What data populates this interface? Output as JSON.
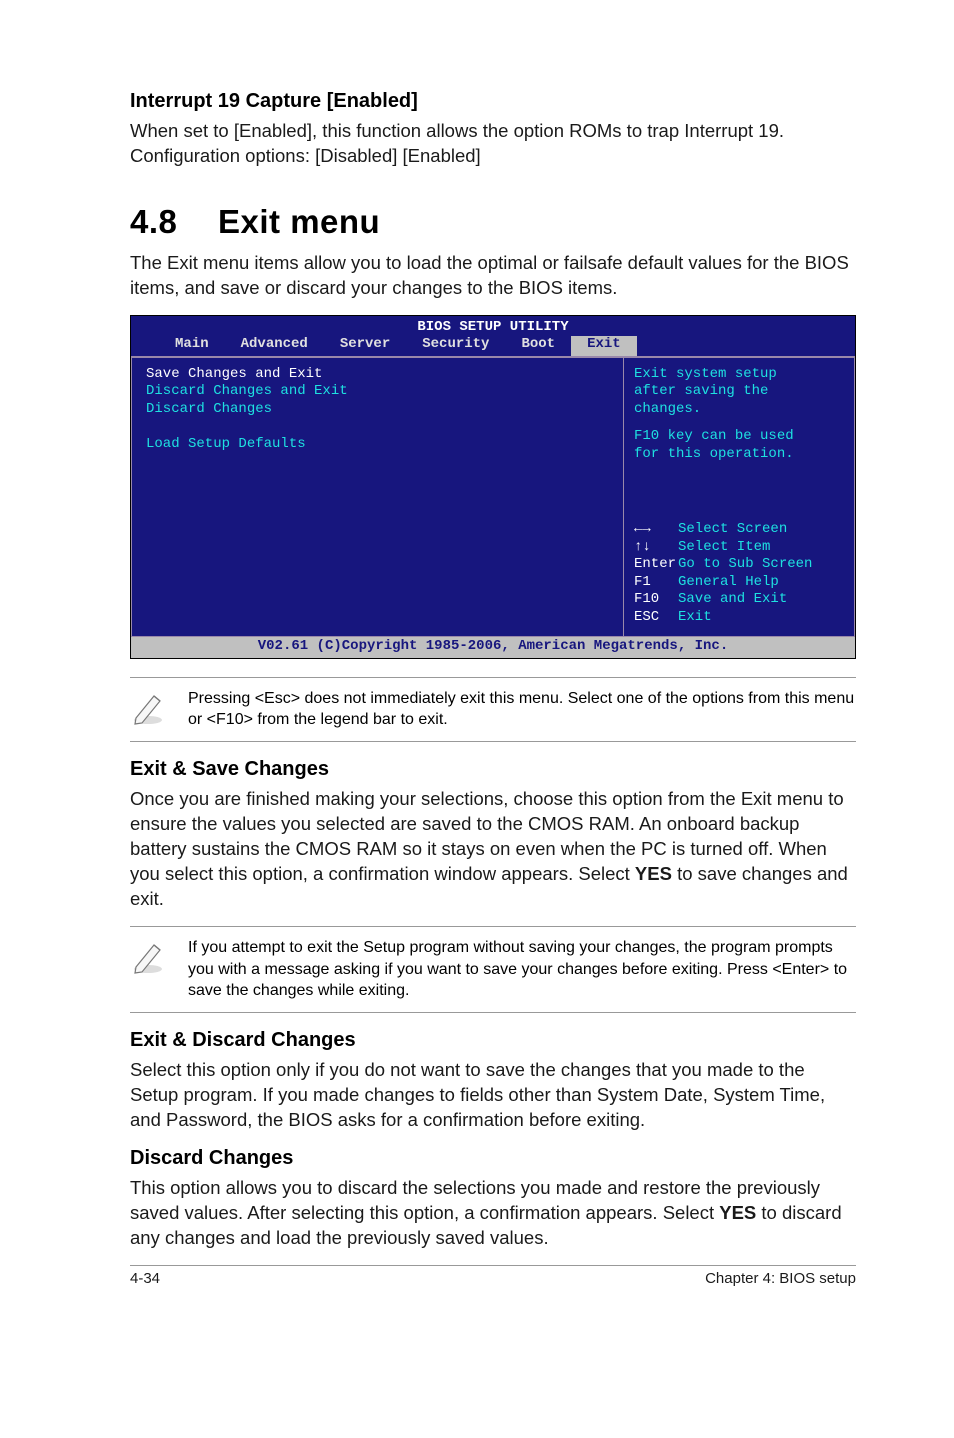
{
  "sec1": {
    "heading": "Interrupt 19 Capture [Enabled]",
    "para": "When set to [Enabled], this function allows the option ROMs to trap Interrupt 19. Configuration options: [Disabled] [Enabled]"
  },
  "sec2": {
    "num": "4.8",
    "title": "Exit menu",
    "intro": "The Exit menu items allow you to load the optimal or failsafe default values for the BIOS items, and save or discard your changes to the BIOS items."
  },
  "bios": {
    "title": "BIOS SETUP UTILITY",
    "tabs": [
      "Main",
      "Advanced",
      "Server",
      "Security",
      "Boot",
      "Exit"
    ],
    "left": {
      "l1": "Save Changes and Exit",
      "l2": "Discard Changes and Exit",
      "l3": "Discard Changes",
      "l4": "Load Setup Defaults"
    },
    "help": {
      "h1": "Exit system setup",
      "h2": "after saving the",
      "h3": "changes.",
      "h4": "F10 key can be used",
      "h5": "for this operation."
    },
    "nav": {
      "k1": "←→",
      "v1": "Select Screen",
      "k2": "↑↓",
      "v2": "Select Item",
      "k3": "Enter",
      "v3": "Go to Sub Screen",
      "k4": "F1",
      "v4": "General Help",
      "k5": "F10",
      "v5": "Save and Exit",
      "k6": "ESC",
      "v6": "Exit"
    },
    "footer": "V02.61 (C)Copyright 1985-2006, American Megatrends, Inc."
  },
  "note1": "Pressing <Esc> does not immediately exit this menu. Select one of the options from this menu or <F10> from the legend bar to exit.",
  "sec3": {
    "heading": "Exit & Save Changes",
    "p1a": "Once you are finished making your selections, choose this option from the Exit menu to ensure the values you selected are saved to the CMOS RAM. An onboard backup battery sustains the CMOS RAM so it stays on even when the PC is turned off. When you select this option, a confirmation window appears. Select ",
    "p1b": "YES",
    "p1c": " to save changes and exit."
  },
  "note2": "If you attempt to exit the Setup program without saving your changes, the program prompts you with a message asking if you want to save your changes before exiting. Press <Enter> to save the changes while exiting.",
  "sec4": {
    "heading": "Exit & Discard Changes",
    "para": "Select this option only if you do not want to save the changes that you  made to the Setup program. If you made changes to fields other than System Date, System Time, and Password, the BIOS asks for a confirmation before exiting."
  },
  "sec5": {
    "heading": "Discard Changes",
    "p1a": "This option allows you to discard the selections you made and restore the previously saved values. After selecting this option, a confirmation appears. Select ",
    "p1b": "YES",
    "p1c": " to discard any changes and load the previously saved values."
  },
  "footer": {
    "left": "4-34",
    "right": "Chapter 4: BIOS setup"
  }
}
